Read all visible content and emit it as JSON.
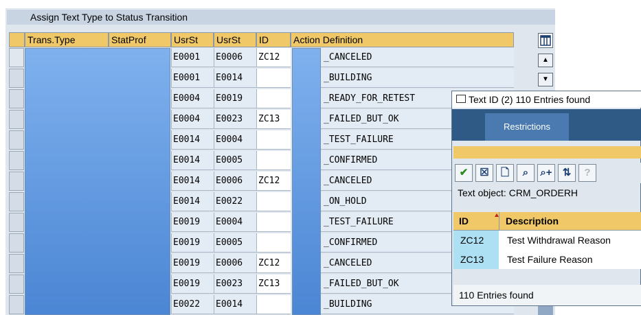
{
  "table": {
    "title": "Assign Text Type to Status Transition",
    "columns": [
      "Trans.Type",
      "StatProf",
      "UsrSt",
      "UsrSt",
      "ID",
      "Action Definition"
    ],
    "rows": [
      {
        "from": "E0001",
        "to": "E0006",
        "id": "ZC12",
        "action": "_CANCELED"
      },
      {
        "from": "E0001",
        "to": "E0014",
        "id": "",
        "action": "_BUILDING"
      },
      {
        "from": "E0004",
        "to": "E0019",
        "id": "",
        "action": "_READY_FOR_RETEST"
      },
      {
        "from": "E0004",
        "to": "E0023",
        "id": "ZC13",
        "action": "_FAILED_BUT_OK"
      },
      {
        "from": "E0014",
        "to": "E0004",
        "id": "",
        "action": "_TEST_FAILURE"
      },
      {
        "from": "E0014",
        "to": "E0005",
        "id": "",
        "action": "_CONFIRMED"
      },
      {
        "from": "E0014",
        "to": "E0006",
        "id": "ZC12",
        "action": "_CANCELED"
      },
      {
        "from": "E0014",
        "to": "E0022",
        "id": "",
        "action": "_ON_HOLD"
      },
      {
        "from": "E0019",
        "to": "E0004",
        "id": "",
        "action": "_TEST_FAILURE"
      },
      {
        "from": "E0019",
        "to": "E0005",
        "id": "",
        "action": "_CONFIRMED"
      },
      {
        "from": "E0019",
        "to": "E0006",
        "id": "ZC12",
        "action": "_CANCELED"
      },
      {
        "from": "E0019",
        "to": "E0023",
        "id": "ZC13",
        "action": "_FAILED_BUT_OK"
      },
      {
        "from": "E0022",
        "to": "E0014",
        "id": "",
        "action": "_BUILDING"
      }
    ]
  },
  "popup": {
    "title": "Text ID (2)  110 Entries found",
    "tab_label": "Restrictions",
    "text_object": "Text object: CRM_ORDERH",
    "columns": [
      "ID",
      "Description"
    ],
    "items": [
      {
        "id": "ZC12",
        "description": "Test Withdrawal Reason"
      },
      {
        "id": "ZC13",
        "description": "Test Failure Reason"
      }
    ],
    "footer": "110 Entries found",
    "toolbar_icons": [
      "check-icon",
      "cancel-icon",
      "new-document-icon",
      "find-icon",
      "find-next-icon",
      "sort-icon",
      "help-icon"
    ],
    "toolbar_glyphs": [
      "✔",
      "☒",
      "🗋",
      "⌕",
      "⌕+",
      "⇅",
      "?"
    ]
  },
  "colors": {
    "header": "#f0c868",
    "row_bg": "#e3ebf4",
    "selection_blue": "#4b86d4",
    "popup_tab": "#2f5a86",
    "id_highlight": "#aee0f4"
  }
}
